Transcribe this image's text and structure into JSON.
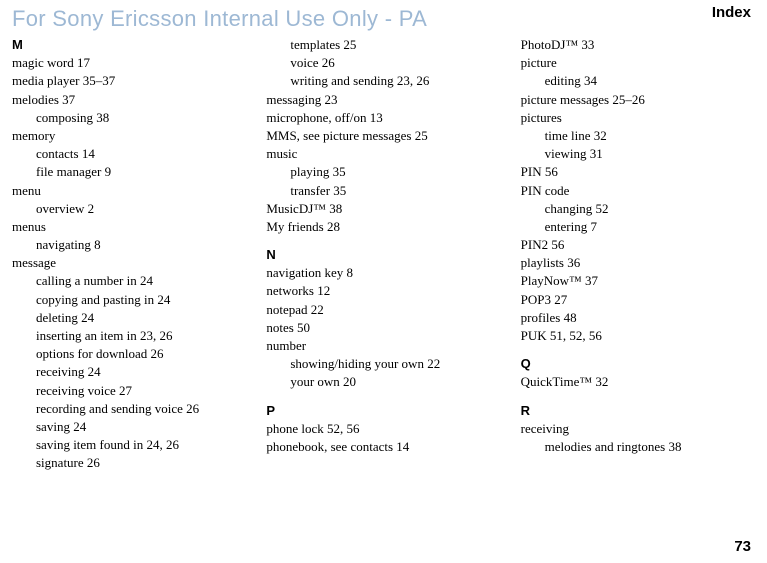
{
  "watermark": "For Sony Ericsson Internal Use Only - PA",
  "page_title": "Index",
  "page_number": "73",
  "col1": {
    "letter_m": "M",
    "magic_word": "magic word 17",
    "media_player": "media player 35–37",
    "melodies": "melodies 37",
    "melodies_composing": "composing 38",
    "memory": "memory",
    "memory_contacts": "contacts 14",
    "memory_file_manager": "file manager 9",
    "menu": "menu",
    "menu_overview": "overview 2",
    "menus": "menus",
    "menus_navigating": "navigating 8",
    "message": "message",
    "message_calling": "calling a number in 24",
    "message_copying": "copying and pasting in 24",
    "message_deleting": "deleting 24",
    "message_inserting": "inserting an item in 23, 26",
    "message_options": "options for download 26",
    "message_receiving": "receiving 24",
    "message_receiving_voice": "receiving voice 27",
    "message_recording": "recording and sending voice 26",
    "message_saving": "saving 24",
    "message_saving_item": "saving item found in 24, 26",
    "message_signature": "signature 26"
  },
  "col2": {
    "message_templates": "templates 25",
    "message_voice": "voice 26",
    "message_writing": "writing and sending 23, 26",
    "messaging": "messaging 23",
    "microphone": "microphone, off/on 13",
    "mms": "MMS, see picture messages 25",
    "music": "music",
    "music_playing": "playing 35",
    "music_transfer": "transfer 35",
    "musicdj": "MusicDJ™ 38",
    "my_friends": "My friends 28",
    "letter_n": "N",
    "navigation_key": "navigation key 8",
    "networks": "networks 12",
    "notepad": "notepad 22",
    "notes": "notes 50",
    "number": "number",
    "number_showing": "showing/hiding your own 22",
    "number_your_own": "your own 20",
    "letter_p": "P",
    "phone_lock": "phone lock 52, 56",
    "phonebook": "phonebook, see contacts 14"
  },
  "col3": {
    "photodj": "PhotoDJ™ 33",
    "picture": "picture",
    "picture_editing": "editing 34",
    "picture_messages": "picture messages 25–26",
    "pictures": "pictures",
    "pictures_timeline": "time line 32",
    "pictures_viewing": "viewing 31",
    "pin": "PIN 56",
    "pin_code": "PIN code",
    "pin_code_changing": "changing 52",
    "pin_code_entering": "entering 7",
    "pin2": "PIN2 56",
    "playlists": "playlists 36",
    "playnow": "PlayNow™ 37",
    "pop3": "POP3 27",
    "profiles": "profiles 48",
    "puk": "PUK 51, 52, 56",
    "letter_q": "Q",
    "quicktime": "QuickTime™ 32",
    "letter_r": "R",
    "receiving": "receiving",
    "receiving_melodies": "melodies and ringtones 38"
  }
}
